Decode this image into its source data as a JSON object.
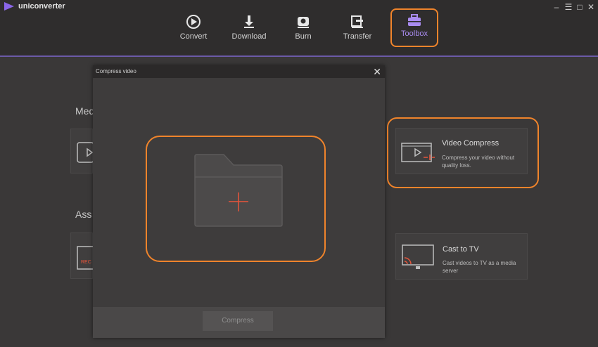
{
  "app": {
    "name": "uniconverter"
  },
  "window_controls": {
    "minimize": "–",
    "restore": "☰",
    "maximize": "□",
    "close": "✕"
  },
  "nav": {
    "items": [
      {
        "label": "Convert",
        "icon": "convert-icon"
      },
      {
        "label": "Download",
        "icon": "download-icon"
      },
      {
        "label": "Burn",
        "icon": "burn-icon"
      },
      {
        "label": "Transfer",
        "icon": "transfer-icon"
      },
      {
        "label": "Toolbox",
        "icon": "toolbox-icon",
        "active": true
      }
    ]
  },
  "sections": {
    "media": {
      "title": "Med"
    },
    "assistant": {
      "title": "Ass"
    }
  },
  "cards": {
    "video_compress": {
      "title": "Video Compress",
      "desc": "Compress your video without quality loss."
    },
    "cast_tv": {
      "title": "Cast to TV",
      "desc": "Cast videos to TV as a media server"
    },
    "rec_label": "REC"
  },
  "dialog": {
    "title": "Compress video",
    "close": "✕",
    "compress_button": "Compress"
  },
  "colors": {
    "accent_orange": "#f0842b",
    "accent_purple": "#a98cf0",
    "plus_red": "#e8553b"
  }
}
